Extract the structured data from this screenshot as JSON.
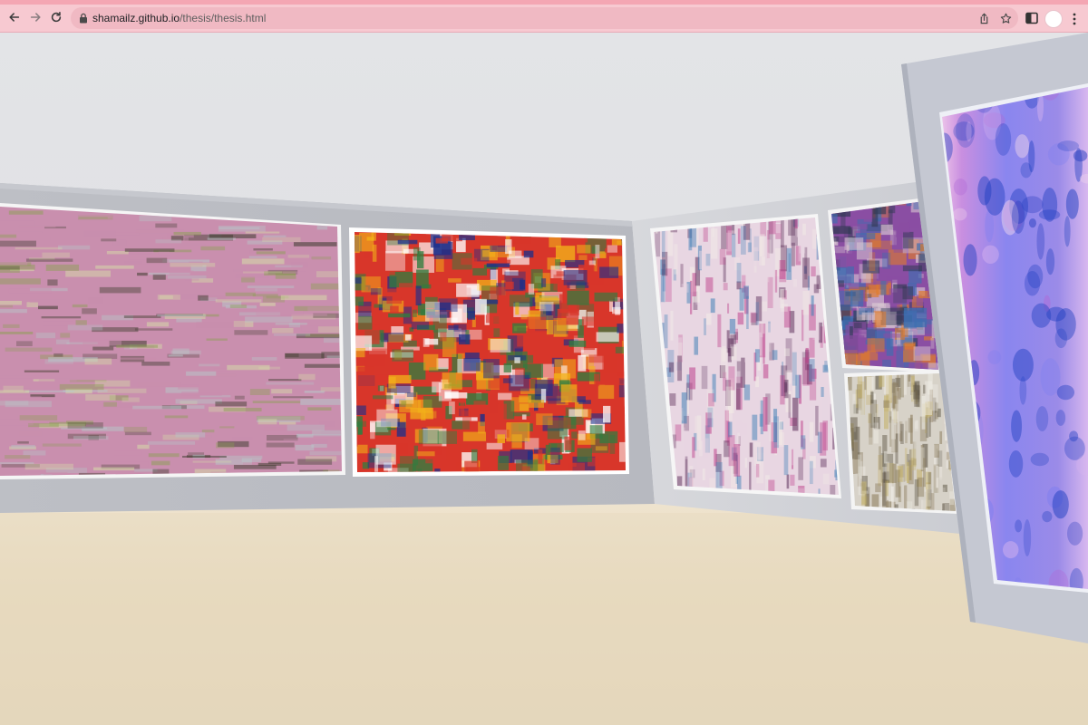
{
  "browser": {
    "url_host": "shamailz.github.io",
    "url_path": "/thesis/thesis.html",
    "theme": {
      "chrome": "#f7c9d1",
      "omnibox": "#f0b9c3",
      "accent_strip": "#f4a6b3"
    },
    "icons": [
      "back-icon",
      "forward-icon",
      "reload-icon",
      "lock-icon",
      "share-icon",
      "star-icon",
      "side-panel-icon",
      "profile-avatar",
      "more-menu-icon"
    ]
  },
  "gallery": {
    "paintings": [
      {
        "name": "abstract-painting-pink-green-horizontal",
        "palette": [
          "#c98fae",
          "#d7e0a8",
          "#8c9f54",
          "#b7c7c9",
          "#3a3a2a"
        ]
      },
      {
        "name": "abstract-painting-multicolor-burst",
        "palette": [
          "#d8362a",
          "#1c2f8a",
          "#f2b21a",
          "#ffffff",
          "#2f7d3f"
        ]
      },
      {
        "name": "abstract-painting-pastel-vertical",
        "palette": [
          "#e8d6e2",
          "#bd3f8a",
          "#3f7fb6",
          "#f3ede7",
          "#5a2d58"
        ]
      },
      {
        "name": "abstract-painting-small-colorful-pattern",
        "palette": [
          "#8a4ea3",
          "#e07b2a",
          "#3c6fb0",
          "#d9c7d2",
          "#333a55"
        ]
      },
      {
        "name": "abstract-painting-small-gray-brown",
        "palette": [
          "#d7d2c8",
          "#8c7d5e",
          "#c5b26c",
          "#f3f0ea",
          "#5e5646"
        ]
      },
      {
        "name": "abstract-painting-purple-blue-foreground",
        "palette": [
          "#b06ad6",
          "#7d7ef0",
          "#2a3fbf",
          "#d9b4ef",
          "#f0d7ec"
        ]
      }
    ]
  }
}
